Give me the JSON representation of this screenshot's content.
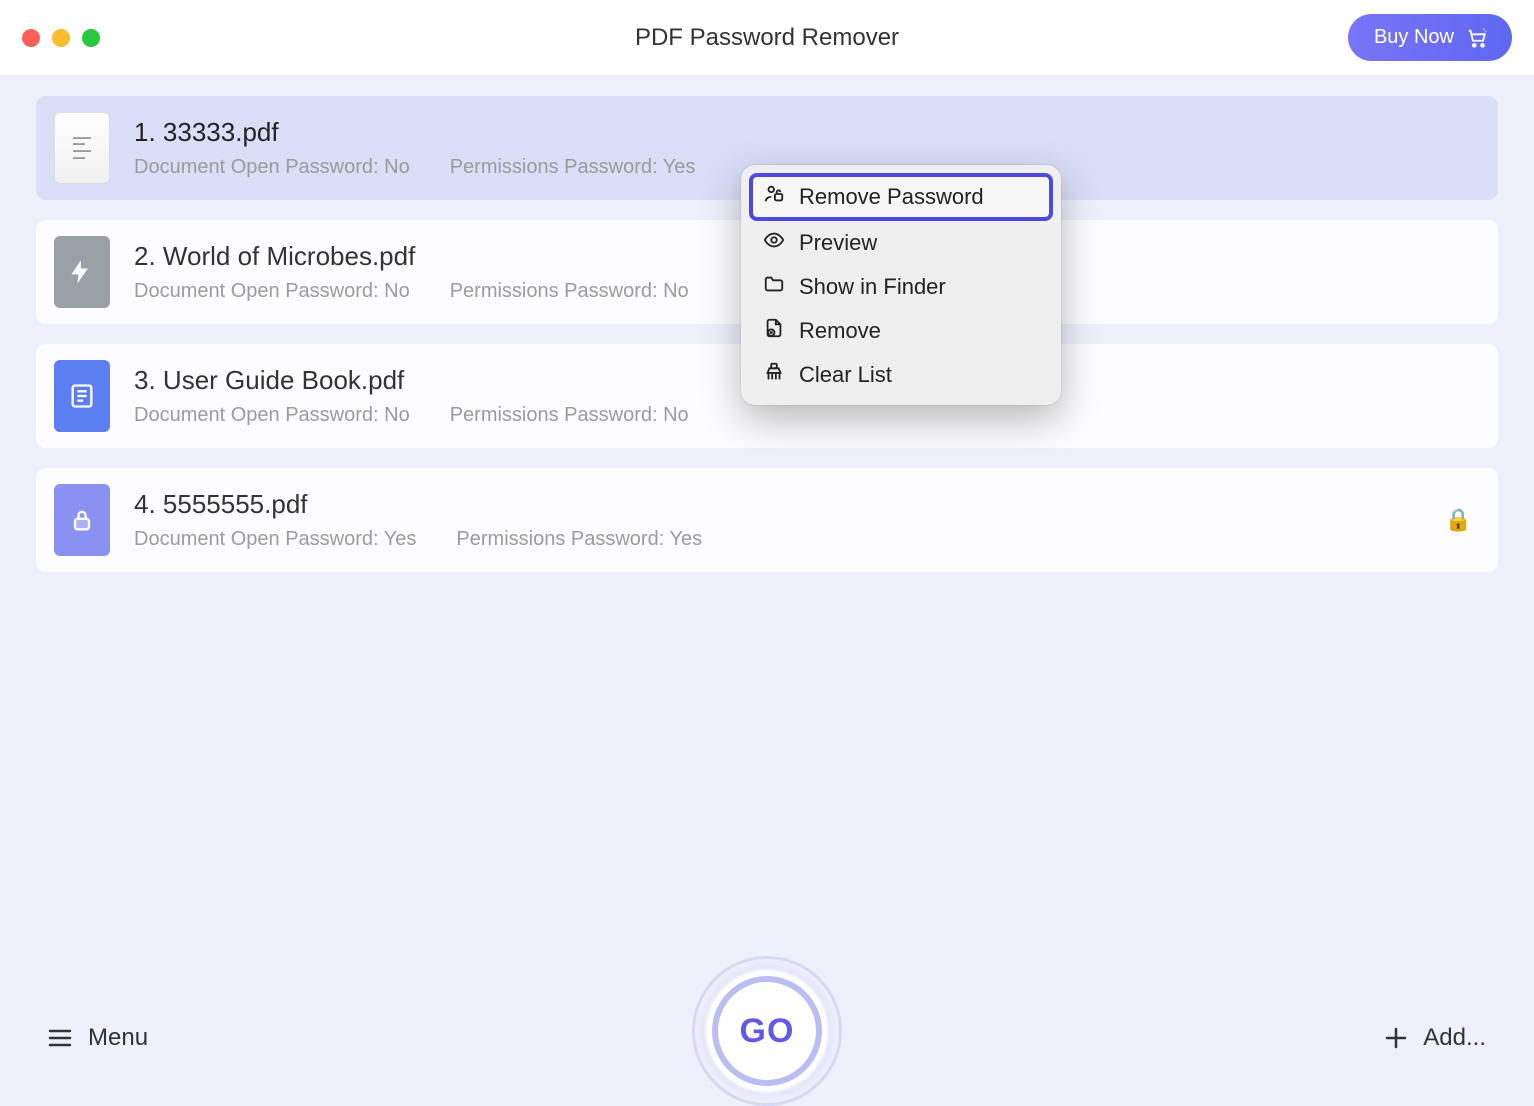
{
  "window": {
    "title": "PDF Password Remover"
  },
  "header": {
    "buy_now_label": "Buy Now"
  },
  "labels": {
    "open_pwd_prefix": "Document Open Password: ",
    "perm_pwd_prefix": "Permissions Password: "
  },
  "files": [
    {
      "index": "1.",
      "name": "33333.pdf",
      "open_password": "No",
      "permissions_password": "Yes",
      "selected": true,
      "locked": false,
      "thumb": "doc"
    },
    {
      "index": "2.",
      "name": "World of Microbes.pdf",
      "open_password": "No",
      "permissions_password": "No",
      "selected": false,
      "locked": false,
      "thumb": "gray"
    },
    {
      "index": "3.",
      "name": "User Guide Book.pdf",
      "open_password": "No",
      "permissions_password": "No",
      "selected": false,
      "locked": false,
      "thumb": "blue"
    },
    {
      "index": "4.",
      "name": "5555555.pdf",
      "open_password": "Yes",
      "permissions_password": "Yes",
      "selected": false,
      "locked": true,
      "thumb": "purple"
    }
  ],
  "context_menu": {
    "items": [
      {
        "label": "Remove Password",
        "icon": "unlock-person",
        "highlighted": true
      },
      {
        "label": "Preview",
        "icon": "eye",
        "highlighted": false
      },
      {
        "label": "Show in Finder",
        "icon": "folder",
        "highlighted": false
      },
      {
        "label": "Remove",
        "icon": "file-x",
        "highlighted": false
      },
      {
        "label": "Clear List",
        "icon": "broom",
        "highlighted": false
      }
    ]
  },
  "footer": {
    "menu_label": "Menu",
    "add_label": "Add...",
    "go_label": "GO"
  },
  "icons": {
    "lock_emoji": "🔒"
  }
}
